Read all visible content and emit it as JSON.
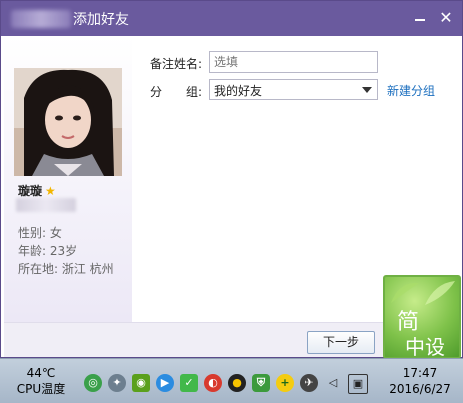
{
  "dialog": {
    "title": "添加好友",
    "close_label": "✕"
  },
  "profile": {
    "name": "璇璇",
    "gender": "性别: 女",
    "age": "年龄: 23岁",
    "location": "所在地: 浙江  杭州"
  },
  "form": {
    "remark_label": "备注姓名:",
    "remark_placeholder": "选填",
    "group_label": "分　　组:",
    "group_value": "我的好友",
    "new_group_link": "新建分组"
  },
  "footer": {
    "next_button": "下一步"
  },
  "watermark": {
    "line1": "简",
    "line2": "中设"
  },
  "taskbar": {
    "cpu_temp": "44℃",
    "cpu_label": "CPU温度",
    "time": "17:47",
    "date": "2016/6/27",
    "tray_icons": [
      "360-icon",
      "bird-icon",
      "nvidia-icon",
      "media-icon",
      "shield-check-icon",
      "netease-music-icon",
      "qq-penguin-icon",
      "security-shield-icon",
      "plus-icon",
      "network-bird-icon",
      "volume-icon",
      "device-icon"
    ]
  },
  "colors": {
    "titlebar": "#6a5a9e",
    "link": "#1c6fbf",
    "accent_star": "#f2b600"
  }
}
